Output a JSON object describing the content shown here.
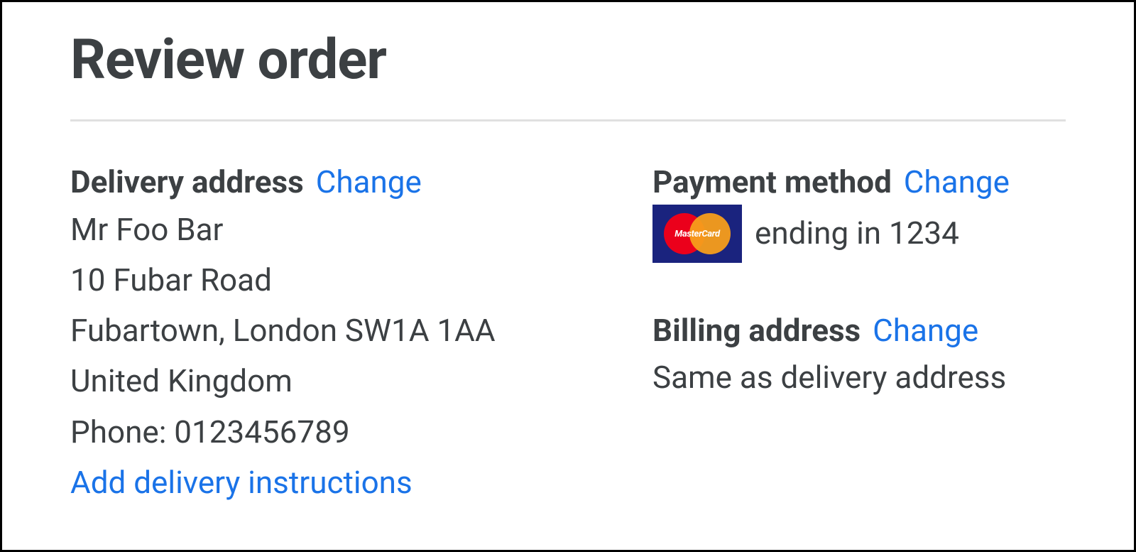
{
  "title": "Review order",
  "change_label": "Change",
  "delivery": {
    "heading": "Delivery address",
    "name": "Mr Foo Bar",
    "line1": "10 Fubar Road",
    "line2": "Fubartown, London SW1A 1AA",
    "country": "United Kingdom",
    "phone": "Phone: 0123456789",
    "add_instructions": "Add delivery instructions"
  },
  "payment": {
    "heading": "Payment method",
    "card_brand": "MasterCard",
    "summary": "ending in 1234"
  },
  "billing": {
    "heading": "Billing address",
    "summary": "Same as delivery address"
  }
}
